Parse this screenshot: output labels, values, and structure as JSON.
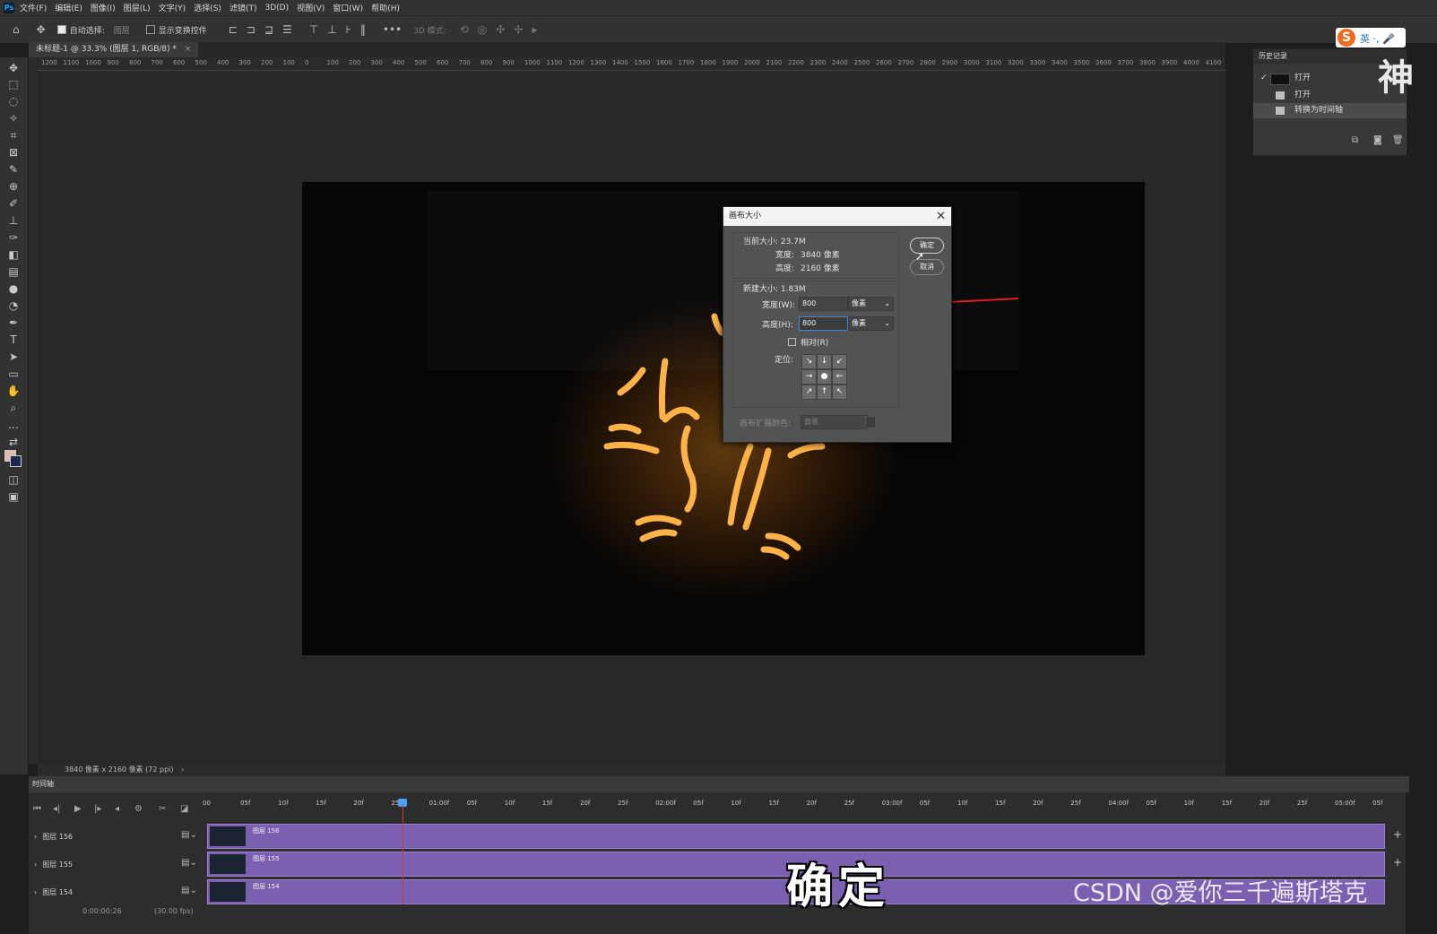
{
  "menubar": {
    "items": [
      "文件(F)",
      "编辑(E)",
      "图像(I)",
      "图层(L)",
      "文字(Y)",
      "选择(S)",
      "滤镜(T)",
      "3D(D)",
      "视图(V)",
      "窗口(W)",
      "帮助(H)"
    ]
  },
  "options": {
    "auto_select_label": "自动选择:",
    "auto_select_value": "图层",
    "show_transform_label": "显示变换控件",
    "mode_3d_label": "3D 模式:"
  },
  "document": {
    "tab_label": "未标题-1 @ 33.3% (图层 1, RGB/8) *",
    "status_text": "3840 像素 x 2160 像素 (72 ppi)"
  },
  "ruler": {
    "ticks": [
      "1200",
      "1100",
      "1000",
      "900",
      "800",
      "700",
      "600",
      "500",
      "400",
      "300",
      "200",
      "100",
      "0",
      "100",
      "200",
      "300",
      "400",
      "500",
      "600",
      "700",
      "800",
      "900",
      "1000",
      "1100",
      "1200",
      "1300",
      "1400",
      "1500",
      "1600",
      "1700",
      "1800",
      "1900",
      "2000",
      "2100",
      "2200",
      "2300",
      "2400",
      "2500",
      "2600",
      "2700",
      "2800",
      "2900",
      "3000",
      "3100",
      "3200",
      "3300",
      "3400",
      "3500",
      "3600",
      "3700",
      "3800",
      "3900",
      "4000",
      "4100",
      "4200"
    ]
  },
  "history": {
    "title": "历史记录",
    "items": [
      {
        "label": "打开",
        "type": "snapshot"
      },
      {
        "label": "打开",
        "type": "step"
      },
      {
        "label": "转换为时间轴",
        "type": "step",
        "selected": true
      }
    ]
  },
  "dialog": {
    "title": "画布大小",
    "current_size_label": "当前大小: 23.7M",
    "current_width_label": "宽度:",
    "current_width_value": "3840 像素",
    "current_height_label": "高度:",
    "current_height_value": "2160 像素",
    "new_size_label": "新建大小: 1.83M",
    "width_label": "宽度(W):",
    "width_value": "800",
    "width_unit": "像素",
    "height_label": "高度(H):",
    "height_value": "800",
    "height_unit": "像素",
    "relative_label": "相对(R)",
    "anchor_label": "定位:",
    "extension_color_label": "画布扩展颜色:",
    "extension_color_value": "背景",
    "ok_label": "确定",
    "cancel_label": "取消"
  },
  "timeline": {
    "tab_label": "时间轴",
    "time_marks": [
      "00",
      "05f",
      "10f",
      "15f",
      "20f",
      "25f",
      "01:00f",
      "05f",
      "10f",
      "15f",
      "20f",
      "25f",
      "02:00f",
      "05f",
      "10f",
      "15f",
      "20f",
      "25f",
      "03:00f",
      "05f",
      "10f",
      "15f",
      "20f",
      "25f",
      "04:00f",
      "05f",
      "10f",
      "15f",
      "20f",
      "25f",
      "05:00f",
      "05f"
    ],
    "layers": [
      {
        "label": "图层 156",
        "clip": "图层 156"
      },
      {
        "label": "图层 155",
        "clip": "图层 155"
      },
      {
        "label": "图层 154",
        "clip": "图层 154"
      }
    ],
    "footer_time": "0:00:00:26",
    "footer_fps": "(30.00 fps)"
  },
  "overlay": {
    "caption": "确定",
    "watermark": "CSDN @爱你三千遍斯塔克",
    "ime_text": "英 ·, 🎤",
    "side_char": "神"
  },
  "colors": {
    "accent_arrow": "#e02020",
    "track_purple": "#7b5fb0",
    "ime_orange": "#ef6c1e"
  }
}
